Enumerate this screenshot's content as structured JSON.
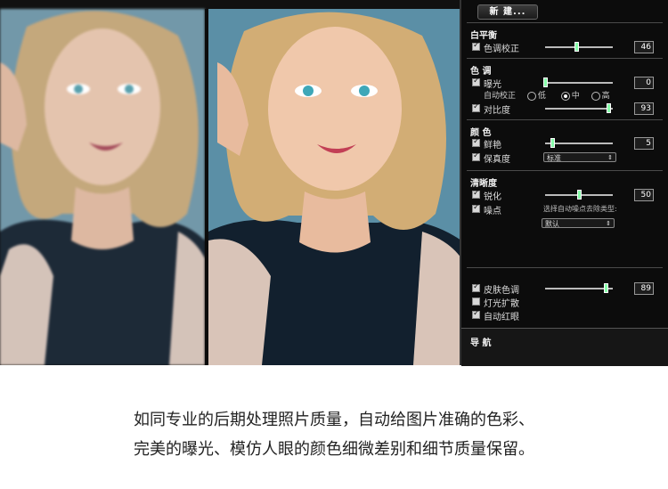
{
  "panel": {
    "new_button": "新 建...",
    "white_balance": {
      "title": "白平衡",
      "color_correction": {
        "label": "色调校正",
        "checked": true,
        "value": "46",
        "level": 0.46
      }
    },
    "tone": {
      "title": "色 调",
      "exposure": {
        "label": "曝光",
        "checked": true,
        "value": "0",
        "level": 0.0
      },
      "auto_correct": {
        "label": "自动校正",
        "options": [
          "低",
          "中",
          "高"
        ],
        "selected": "中"
      },
      "contrast": {
        "label": "对比度",
        "checked": true,
        "value": "93",
        "level": 0.93
      }
    },
    "color": {
      "title": "颜 色",
      "vibrance": {
        "label": "鲜艳",
        "checked": true,
        "value": "5",
        "level": 0.1
      },
      "fidelity": {
        "label": "保真度",
        "checked": true,
        "selected": "标准"
      }
    },
    "clarity": {
      "title": "清晰度",
      "sharpen": {
        "label": "锐化",
        "checked": true,
        "value": "50",
        "level": 0.5
      },
      "noise": {
        "label": "噪点",
        "checked": true,
        "hint": "选择自动噪点去除类型:",
        "selected": "默认"
      }
    },
    "skin": {
      "skin_tone": {
        "label": "皮肤色调",
        "checked": true,
        "value": "89",
        "level": 0.89
      },
      "light_diffuse": {
        "label": "灯光扩散",
        "checked": false
      },
      "red_eye": {
        "label": "自动红眼",
        "checked": true
      }
    },
    "nav_title": "导 航"
  },
  "caption": {
    "line1": "如同专业的后期处理照片质量，自动给图片准确的色彩、",
    "line2": "完美的曝光、模仿人眼的颜色细微差别和细节质量保留。"
  },
  "colors": {
    "panel_bg": "#0c0c0c",
    "slider_knob": "#88ffaa",
    "photo_bg": "#5b8fa6"
  }
}
